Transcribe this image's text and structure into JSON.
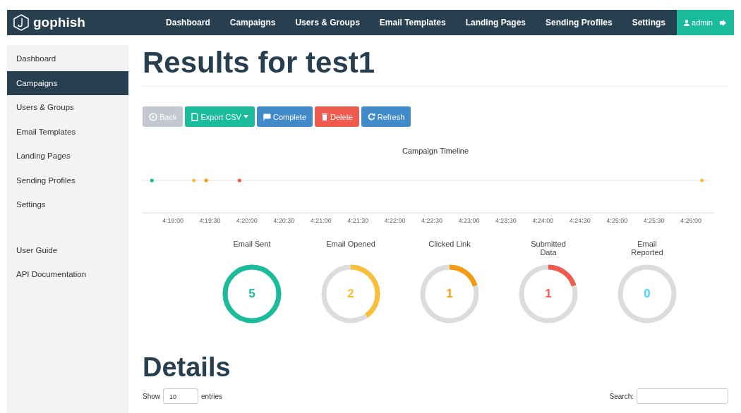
{
  "navbar": {
    "brand": "gophish",
    "items": [
      {
        "label": "Dashboard"
      },
      {
        "label": "Campaigns"
      },
      {
        "label": "Users & Groups"
      },
      {
        "label": "Email Templates"
      },
      {
        "label": "Landing Pages"
      },
      {
        "label": "Sending Profiles"
      },
      {
        "label": "Settings"
      }
    ],
    "user": "admin"
  },
  "sidebar": {
    "items": [
      {
        "label": "Dashboard",
        "selected": false
      },
      {
        "label": "Campaigns",
        "selected": true
      },
      {
        "label": "Users & Groups",
        "selected": false
      },
      {
        "label": "Email Templates",
        "selected": false
      },
      {
        "label": "Landing Pages",
        "selected": false
      },
      {
        "label": "Sending Profiles",
        "selected": false
      },
      {
        "label": "Settings",
        "selected": false
      }
    ],
    "links": [
      {
        "label": "User Guide"
      },
      {
        "label": "API Documentation"
      }
    ]
  },
  "title": "Results for test1",
  "buttons": [
    {
      "label": "Back",
      "kind": "default",
      "disabled": true
    },
    {
      "label": "Export CSV",
      "kind": "success",
      "disabled": false
    },
    {
      "label": "Complete",
      "kind": "primary",
      "disabled": false
    },
    {
      "label": "Delete",
      "kind": "danger",
      "disabled": false
    },
    {
      "label": "Refresh",
      "kind": "primary",
      "disabled": false
    }
  ],
  "timeline": {
    "title": "Campaign Timeline",
    "axis_labels": [
      "4:19:00",
      "4:19:30",
      "4:20:00",
      "4:20:30",
      "4:21:00",
      "4:21:30",
      "4:22:00",
      "4:22:30",
      "4:23:00",
      "4:23:30",
      "4:24:00",
      "4:24:30",
      "4:25:00",
      "4:25:30",
      "4:26:00"
    ]
  },
  "stats": [
    {
      "label": "Email Sent",
      "value": "5",
      "level": 1,
      "color": "#1abc9c"
    },
    {
      "label": "Email Opened",
      "value": "2",
      "level": 0.4,
      "color": "#f9bf3b"
    },
    {
      "label": "Clicked Link",
      "value": "1",
      "level": 0.2,
      "color": "#f39c12"
    },
    {
      "label": "Submitted Data",
      "value": "1",
      "level": 0.2,
      "color": "#f05b4f"
    },
    {
      "label": "Email Reported",
      "value": "0",
      "level": 0,
      "color": "#45d6ef"
    }
  ],
  "details": {
    "title": "Details",
    "show_label": "Show",
    "page_size": "10",
    "entries_label": "entries",
    "search_label": "Search:"
  }
}
